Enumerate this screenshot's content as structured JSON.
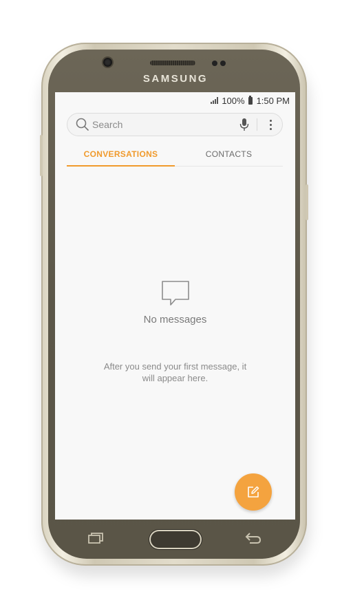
{
  "device": {
    "brand": "SAMSUNG"
  },
  "status_bar": {
    "battery": "100%",
    "time": "1:50 PM"
  },
  "search": {
    "placeholder": "Search",
    "value": ""
  },
  "tabs": [
    {
      "label": "CONVERSATIONS",
      "active": true
    },
    {
      "label": "CONTACTS",
      "active": false
    }
  ],
  "empty_state": {
    "title": "No messages",
    "description": "After you send your first message, it will appear here."
  },
  "colors": {
    "accent": "#f09a2c",
    "fab": "#f4a33f"
  },
  "icons": {
    "search": "search-icon",
    "mic": "mic-icon",
    "more": "more-vert-icon",
    "empty": "chat-bubble-icon",
    "compose": "compose-icon",
    "recent": "recent-apps-icon",
    "back": "back-icon"
  }
}
